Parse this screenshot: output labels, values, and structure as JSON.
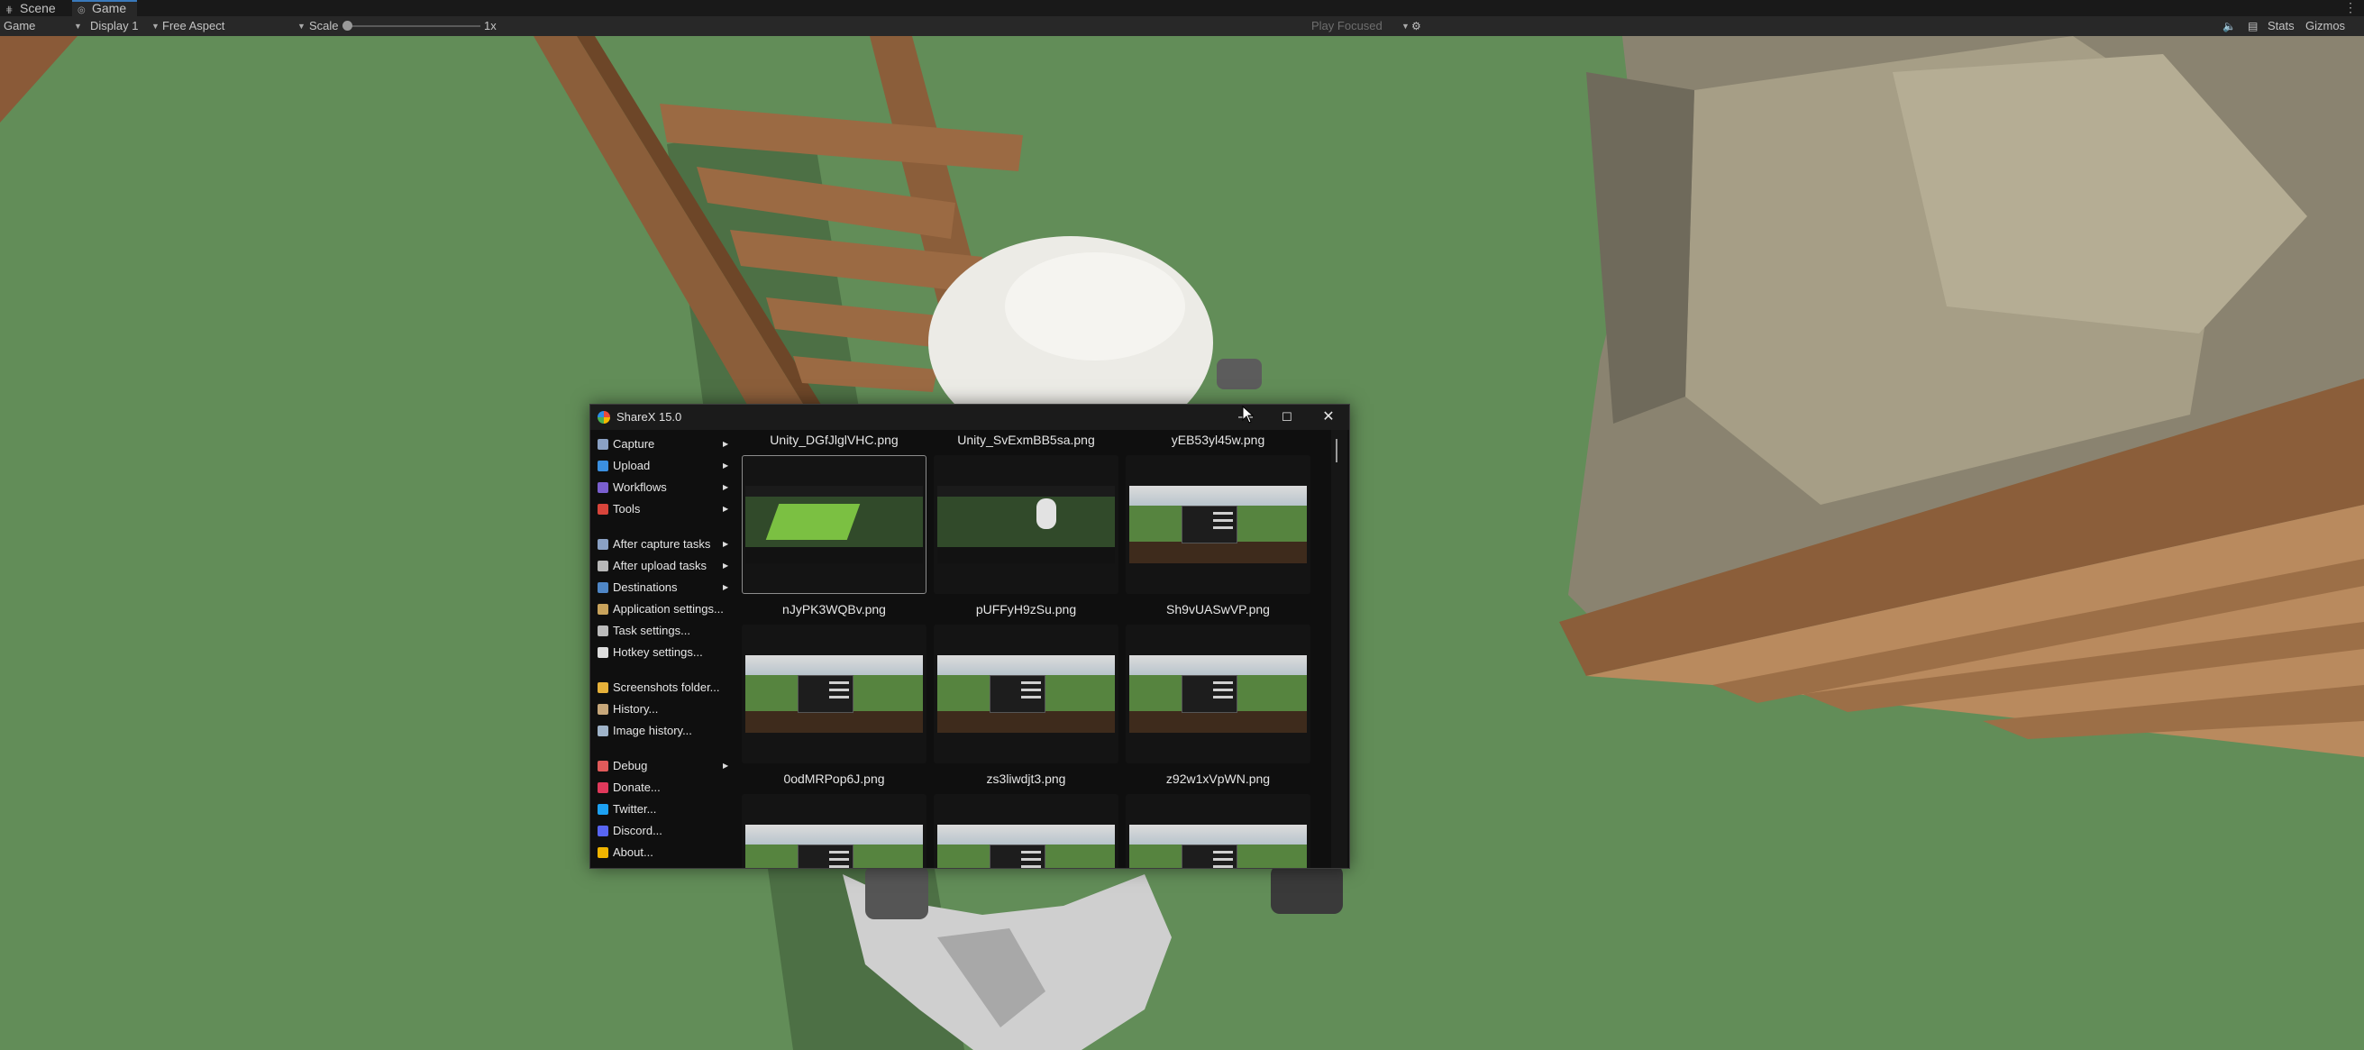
{
  "unity": {
    "tabs": [
      {
        "icon": "scene-icon",
        "label": "Scene"
      },
      {
        "icon": "game-controller-icon",
        "label": "Game"
      }
    ],
    "toolbar": {
      "view": "Game",
      "display": "Display 1",
      "aspect": "Free Aspect",
      "scale_label": "Scale",
      "scale_value": "1x",
      "scale_level": 0,
      "play_mode": "Play Focused",
      "stats": "Stats",
      "gizmos": "Gizmos"
    }
  },
  "sharex": {
    "title": "ShareX 15.0",
    "window_controls": {
      "minimize": "—",
      "maximize": "☐",
      "close": "✕"
    },
    "menu": [
      {
        "label": "Capture",
        "icon": "capture-icon",
        "color": "#8aa1c4",
        "submenu": true
      },
      {
        "label": "Upload",
        "icon": "upload-icon",
        "color": "#3b8fe0",
        "submenu": true
      },
      {
        "label": "Workflows",
        "icon": "workflows-icon",
        "color": "#7a5fcf",
        "submenu": true
      },
      {
        "label": "Tools",
        "icon": "tools-icon",
        "color": "#d8453b",
        "submenu": true
      },
      {
        "label": "After capture tasks",
        "icon": "after-capture-icon",
        "color": "#8aa1c4",
        "submenu": true
      },
      {
        "label": "After upload tasks",
        "icon": "after-upload-icon",
        "color": "#b8b8b8",
        "submenu": true
      },
      {
        "label": "Destinations",
        "icon": "destinations-icon",
        "color": "#4f86c6",
        "submenu": true
      },
      {
        "label": "Application settings...",
        "icon": "application-settings-icon",
        "color": "#c9a35c",
        "submenu": false
      },
      {
        "label": "Task settings...",
        "icon": "task-settings-icon",
        "color": "#bbbbbb",
        "submenu": false
      },
      {
        "label": "Hotkey settings...",
        "icon": "hotkey-settings-icon",
        "color": "#dddddd",
        "submenu": false
      },
      {
        "label": "Screenshots folder...",
        "icon": "screenshots-folder-icon",
        "color": "#e6b13a",
        "submenu": false
      },
      {
        "label": "History...",
        "icon": "history-icon",
        "color": "#c7a77a",
        "submenu": false
      },
      {
        "label": "Image history...",
        "icon": "image-history-icon",
        "color": "#9fb3c8",
        "submenu": false
      },
      {
        "label": "Debug",
        "icon": "debug-icon",
        "color": "#e05a5a",
        "submenu": true
      },
      {
        "label": "Donate...",
        "icon": "donate-icon",
        "color": "#e0395b",
        "submenu": false
      },
      {
        "label": "Twitter...",
        "icon": "twitter-icon",
        "color": "#1da1f2",
        "submenu": false
      },
      {
        "label": "Discord...",
        "icon": "discord-icon",
        "color": "#5865f2",
        "submenu": false
      },
      {
        "label": "About...",
        "icon": "about-icon",
        "color": "#f0b400",
        "submenu": false
      }
    ],
    "files": [
      "Unity_DGfJlglVHC.png",
      "Unity_SvExmBB5sa.png",
      "yEB53yl45w.png",
      "nJyPK3WQBv.png",
      "pUFFyH9zSu.png",
      "Sh9vUASwVP.png",
      "0odMRPop6J.png",
      "zs3liwdjt3.png",
      "z92w1xVpWN.png"
    ],
    "selected_index": 0
  }
}
